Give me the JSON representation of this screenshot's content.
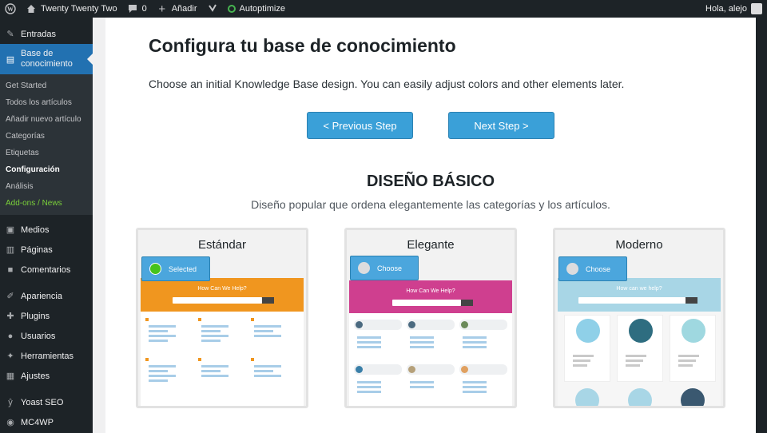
{
  "adminbar": {
    "site_name": "Twenty Twenty Two",
    "comments_count": "0",
    "new_label": "Añadir",
    "autoptimize_label": "Autoptimize",
    "greeting": "Hola, alejo"
  },
  "sidebar": {
    "top_items": [
      {
        "label": "Entradas",
        "icon": "pin-icon"
      }
    ],
    "current": {
      "label_line1": "Base de",
      "label_line2": "conocimiento",
      "icon": "book-icon"
    },
    "submenu": [
      "Get Started",
      "Todos los artículos",
      "Añadir nuevo artículo",
      "Categorías",
      "Etiquetas",
      "Configuración",
      "Análisis",
      "Add-ons / News"
    ],
    "bottom_items": [
      {
        "label": "Medios",
        "icon": "media-icon"
      },
      {
        "label": "Páginas",
        "icon": "pages-icon"
      },
      {
        "label": "Comentarios",
        "icon": "comments-icon"
      },
      {
        "label": "Apariencia",
        "icon": "brush-icon"
      },
      {
        "label": "Plugins",
        "icon": "plugin-icon"
      },
      {
        "label": "Usuarios",
        "icon": "user-icon"
      },
      {
        "label": "Herramientas",
        "icon": "wrench-icon"
      },
      {
        "label": "Ajustes",
        "icon": "settings-icon"
      },
      {
        "label": "Yoast SEO",
        "icon": "yoast-icon"
      },
      {
        "label": "MC4WP",
        "icon": "mc4wp-icon"
      }
    ]
  },
  "main": {
    "title": "Configura tu base de conocimiento",
    "description": "Choose an initial Knowledge Base design. You can easily adjust colors and other elements later.",
    "prev_button": "< Previous Step",
    "next_button": "Next Step >",
    "section_heading": "DISEÑO BÁSICO",
    "section_subheading": "Diseño popular que ordena elegantemente las categorías y los artículos."
  },
  "designs": [
    {
      "name": "Estándar",
      "button": "Selected",
      "selected": true,
      "hero_color": "#f0961f",
      "hero_text": "How Can We Help?"
    },
    {
      "name": "Elegante",
      "button": "Choose",
      "selected": false,
      "hero_color": "#cf3f8f",
      "hero_text": "How Can We Help?"
    },
    {
      "name": "Moderno",
      "button": "Choose",
      "selected": false,
      "hero_color": "#a8d6e6",
      "hero_text": "How can we help?"
    }
  ],
  "colors": {
    "accent": "#2271b1",
    "button": "#3aa0d8",
    "admin_bg": "#1d2327",
    "addons": "#7ad03a"
  }
}
